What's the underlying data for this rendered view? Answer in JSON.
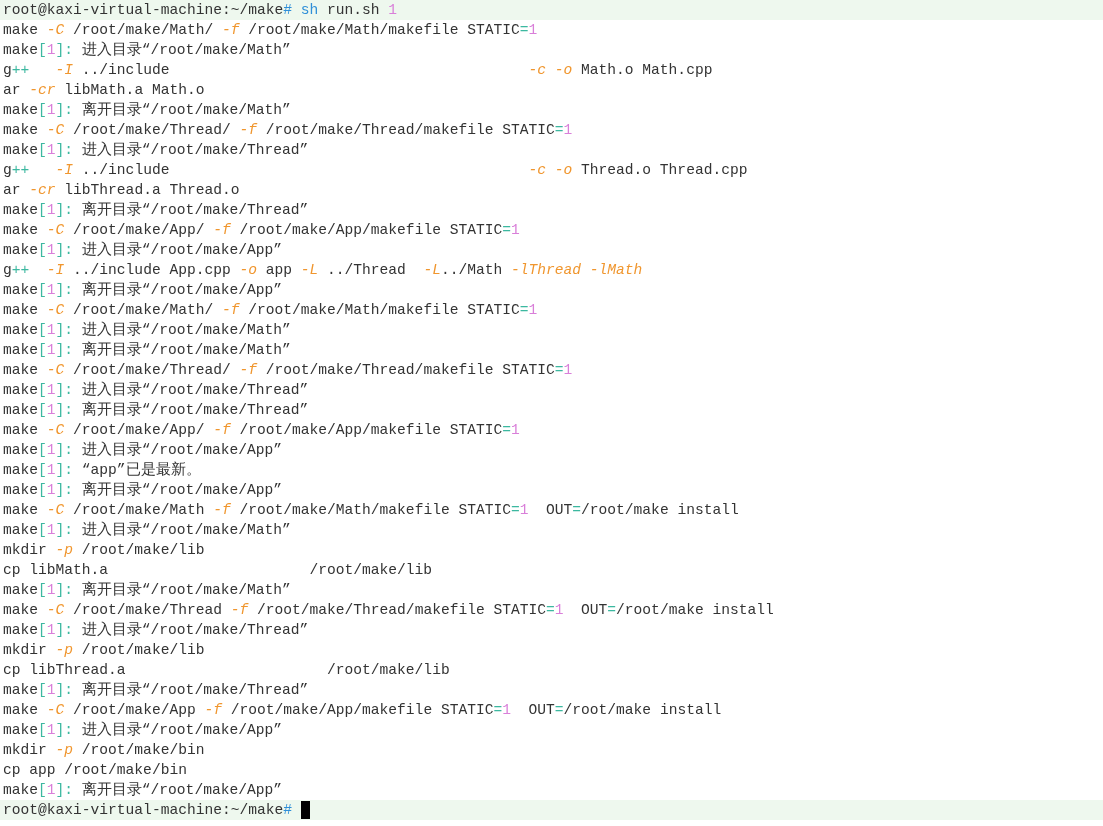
{
  "terminal": {
    "cursor": true,
    "lines": [
      {
        "kind": "prompt",
        "segments": [
          {
            "text": "root@kaxi-virtual-machine:~/make"
          },
          {
            "text": "#",
            "kind": "keyword"
          },
          {
            "text": " sh",
            "kind": "keyword"
          },
          {
            "text": " run.sh "
          },
          {
            "text": "1",
            "kind": "number"
          }
        ]
      },
      {
        "kind": "output",
        "segments": [
          {
            "text": "make "
          },
          {
            "text": "-C",
            "kind": "option"
          },
          {
            "text": " /root/make/Math/ "
          },
          {
            "text": "-f",
            "kind": "option"
          },
          {
            "text": " /root/make/Math/makefile STATIC"
          },
          {
            "text": "=",
            "kind": "symbol"
          },
          {
            "text": "1",
            "kind": "number"
          }
        ]
      },
      {
        "kind": "output",
        "segments": [
          {
            "text": "make"
          },
          {
            "text": "[",
            "kind": "symbol"
          },
          {
            "text": "1",
            "kind": "number"
          },
          {
            "text": "]:",
            "kind": "symbol"
          },
          {
            "text": " 进入目录“/root/make/Math”"
          }
        ]
      },
      {
        "kind": "output",
        "segments": [
          {
            "text": "g"
          },
          {
            "text": "++",
            "kind": "symbol"
          },
          {
            "text": "   -I",
            "kind": "option"
          },
          {
            "text": " ../include                                         "
          },
          {
            "text": "-c",
            "kind": "option"
          },
          {
            "text": " -o",
            "kind": "option"
          },
          {
            "text": " Math.o Math.cpp"
          }
        ]
      },
      {
        "kind": "output",
        "segments": [
          {
            "text": "ar "
          },
          {
            "text": "-cr",
            "kind": "option"
          },
          {
            "text": " libMath.a Math.o"
          }
        ]
      },
      {
        "kind": "output",
        "segments": [
          {
            "text": "make"
          },
          {
            "text": "[",
            "kind": "symbol"
          },
          {
            "text": "1",
            "kind": "number"
          },
          {
            "text": "]:",
            "kind": "symbol"
          },
          {
            "text": " 离开目录“/root/make/Math”"
          }
        ]
      },
      {
        "kind": "output",
        "segments": [
          {
            "text": "make "
          },
          {
            "text": "-C",
            "kind": "option"
          },
          {
            "text": " /root/make/Thread/ "
          },
          {
            "text": "-f",
            "kind": "option"
          },
          {
            "text": " /root/make/Thread/makefile STATIC"
          },
          {
            "text": "=",
            "kind": "symbol"
          },
          {
            "text": "1",
            "kind": "number"
          }
        ]
      },
      {
        "kind": "output",
        "segments": [
          {
            "text": "make"
          },
          {
            "text": "[",
            "kind": "symbol"
          },
          {
            "text": "1",
            "kind": "number"
          },
          {
            "text": "]:",
            "kind": "symbol"
          },
          {
            "text": " 进入目录“/root/make/Thread”"
          }
        ]
      },
      {
        "kind": "output",
        "segments": [
          {
            "text": "g"
          },
          {
            "text": "++",
            "kind": "symbol"
          },
          {
            "text": "   -I",
            "kind": "option"
          },
          {
            "text": " ../include                                         "
          },
          {
            "text": "-c",
            "kind": "option"
          },
          {
            "text": " -o",
            "kind": "option"
          },
          {
            "text": " Thread.o Thread.cpp"
          }
        ]
      },
      {
        "kind": "output",
        "segments": [
          {
            "text": "ar "
          },
          {
            "text": "-cr",
            "kind": "option"
          },
          {
            "text": " libThread.a Thread.o"
          }
        ]
      },
      {
        "kind": "output",
        "segments": [
          {
            "text": "make"
          },
          {
            "text": "[",
            "kind": "symbol"
          },
          {
            "text": "1",
            "kind": "number"
          },
          {
            "text": "]:",
            "kind": "symbol"
          },
          {
            "text": " 离开目录“/root/make/Thread”"
          }
        ]
      },
      {
        "kind": "output",
        "segments": [
          {
            "text": "make "
          },
          {
            "text": "-C",
            "kind": "option"
          },
          {
            "text": " /root/make/App/ "
          },
          {
            "text": "-f",
            "kind": "option"
          },
          {
            "text": " /root/make/App/makefile STATIC"
          },
          {
            "text": "=",
            "kind": "symbol"
          },
          {
            "text": "1",
            "kind": "number"
          }
        ]
      },
      {
        "kind": "output",
        "segments": [
          {
            "text": "make"
          },
          {
            "text": "[",
            "kind": "symbol"
          },
          {
            "text": "1",
            "kind": "number"
          },
          {
            "text": "]:",
            "kind": "symbol"
          },
          {
            "text": " 进入目录“/root/make/App”"
          }
        ]
      },
      {
        "kind": "output",
        "segments": [
          {
            "text": "g"
          },
          {
            "text": "++",
            "kind": "symbol"
          },
          {
            "text": "  -I",
            "kind": "option"
          },
          {
            "text": " ../include App.cpp "
          },
          {
            "text": "-o",
            "kind": "option"
          },
          {
            "text": " app "
          },
          {
            "text": "-L",
            "kind": "option"
          },
          {
            "text": " ../Thread  "
          },
          {
            "text": "-L",
            "kind": "option"
          },
          {
            "text": "../Math "
          },
          {
            "text": "-lThread",
            "kind": "option"
          },
          {
            "text": " -lMath",
            "kind": "option"
          }
        ]
      },
      {
        "kind": "output",
        "segments": [
          {
            "text": "make"
          },
          {
            "text": "[",
            "kind": "symbol"
          },
          {
            "text": "1",
            "kind": "number"
          },
          {
            "text": "]:",
            "kind": "symbol"
          },
          {
            "text": " 离开目录“/root/make/App”"
          }
        ]
      },
      {
        "kind": "output",
        "segments": [
          {
            "text": "make "
          },
          {
            "text": "-C",
            "kind": "option"
          },
          {
            "text": " /root/make/Math/ "
          },
          {
            "text": "-f",
            "kind": "option"
          },
          {
            "text": " /root/make/Math/makefile STATIC"
          },
          {
            "text": "=",
            "kind": "symbol"
          },
          {
            "text": "1",
            "kind": "number"
          }
        ]
      },
      {
        "kind": "output",
        "segments": [
          {
            "text": "make"
          },
          {
            "text": "[",
            "kind": "symbol"
          },
          {
            "text": "1",
            "kind": "number"
          },
          {
            "text": "]:",
            "kind": "symbol"
          },
          {
            "text": " 进入目录“/root/make/Math”"
          }
        ]
      },
      {
        "kind": "output",
        "segments": [
          {
            "text": "make"
          },
          {
            "text": "[",
            "kind": "symbol"
          },
          {
            "text": "1",
            "kind": "number"
          },
          {
            "text": "]:",
            "kind": "symbol"
          },
          {
            "text": " 离开目录“/root/make/Math”"
          }
        ]
      },
      {
        "kind": "output",
        "segments": [
          {
            "text": "make "
          },
          {
            "text": "-C",
            "kind": "option"
          },
          {
            "text": " /root/make/Thread/ "
          },
          {
            "text": "-f",
            "kind": "option"
          },
          {
            "text": " /root/make/Thread/makefile STATIC"
          },
          {
            "text": "=",
            "kind": "symbol"
          },
          {
            "text": "1",
            "kind": "number"
          }
        ]
      },
      {
        "kind": "output",
        "segments": [
          {
            "text": "make"
          },
          {
            "text": "[",
            "kind": "symbol"
          },
          {
            "text": "1",
            "kind": "number"
          },
          {
            "text": "]:",
            "kind": "symbol"
          },
          {
            "text": " 进入目录“/root/make/Thread”"
          }
        ]
      },
      {
        "kind": "output",
        "segments": [
          {
            "text": "make"
          },
          {
            "text": "[",
            "kind": "symbol"
          },
          {
            "text": "1",
            "kind": "number"
          },
          {
            "text": "]:",
            "kind": "symbol"
          },
          {
            "text": " 离开目录“/root/make/Thread”"
          }
        ]
      },
      {
        "kind": "output",
        "segments": [
          {
            "text": "make "
          },
          {
            "text": "-C",
            "kind": "option"
          },
          {
            "text": " /root/make/App/ "
          },
          {
            "text": "-f",
            "kind": "option"
          },
          {
            "text": " /root/make/App/makefile STATIC"
          },
          {
            "text": "=",
            "kind": "symbol"
          },
          {
            "text": "1",
            "kind": "number"
          }
        ]
      },
      {
        "kind": "output",
        "segments": [
          {
            "text": "make"
          },
          {
            "text": "[",
            "kind": "symbol"
          },
          {
            "text": "1",
            "kind": "number"
          },
          {
            "text": "]:",
            "kind": "symbol"
          },
          {
            "text": " 进入目录“/root/make/App”"
          }
        ]
      },
      {
        "kind": "output",
        "segments": [
          {
            "text": "make"
          },
          {
            "text": "[",
            "kind": "symbol"
          },
          {
            "text": "1",
            "kind": "number"
          },
          {
            "text": "]:",
            "kind": "symbol"
          },
          {
            "text": " “app”已是最新。"
          }
        ]
      },
      {
        "kind": "output",
        "segments": [
          {
            "text": "make"
          },
          {
            "text": "[",
            "kind": "symbol"
          },
          {
            "text": "1",
            "kind": "number"
          },
          {
            "text": "]:",
            "kind": "symbol"
          },
          {
            "text": " 离开目录“/root/make/App”"
          }
        ]
      },
      {
        "kind": "output",
        "segments": [
          {
            "text": "make "
          },
          {
            "text": "-C",
            "kind": "option"
          },
          {
            "text": " /root/make/Math "
          },
          {
            "text": "-f",
            "kind": "option"
          },
          {
            "text": " /root/make/Math/makefile STATIC"
          },
          {
            "text": "=",
            "kind": "symbol"
          },
          {
            "text": "1",
            "kind": "number"
          },
          {
            "text": "  OUT"
          },
          {
            "text": "=",
            "kind": "symbol"
          },
          {
            "text": "/root/make install"
          }
        ]
      },
      {
        "kind": "output",
        "segments": [
          {
            "text": "make"
          },
          {
            "text": "[",
            "kind": "symbol"
          },
          {
            "text": "1",
            "kind": "number"
          },
          {
            "text": "]:",
            "kind": "symbol"
          },
          {
            "text": " 进入目录“/root/make/Math”"
          }
        ]
      },
      {
        "kind": "output",
        "segments": [
          {
            "text": "mkdir "
          },
          {
            "text": "-p",
            "kind": "option"
          },
          {
            "text": " /root/make/lib"
          }
        ]
      },
      {
        "kind": "output",
        "segments": [
          {
            "text": "cp libMath.a                       /root/make/lib"
          }
        ]
      },
      {
        "kind": "output",
        "segments": [
          {
            "text": "make"
          },
          {
            "text": "[",
            "kind": "symbol"
          },
          {
            "text": "1",
            "kind": "number"
          },
          {
            "text": "]:",
            "kind": "symbol"
          },
          {
            "text": " 离开目录“/root/make/Math”"
          }
        ]
      },
      {
        "kind": "output",
        "segments": [
          {
            "text": "make "
          },
          {
            "text": "-C",
            "kind": "option"
          },
          {
            "text": " /root/make/Thread "
          },
          {
            "text": "-f",
            "kind": "option"
          },
          {
            "text": " /root/make/Thread/makefile STATIC"
          },
          {
            "text": "=",
            "kind": "symbol"
          },
          {
            "text": "1",
            "kind": "number"
          },
          {
            "text": "  OUT"
          },
          {
            "text": "=",
            "kind": "symbol"
          },
          {
            "text": "/root/make install"
          }
        ]
      },
      {
        "kind": "output",
        "segments": [
          {
            "text": "make"
          },
          {
            "text": "[",
            "kind": "symbol"
          },
          {
            "text": "1",
            "kind": "number"
          },
          {
            "text": "]:",
            "kind": "symbol"
          },
          {
            "text": " 进入目录“/root/make/Thread”"
          }
        ]
      },
      {
        "kind": "output",
        "segments": [
          {
            "text": "mkdir "
          },
          {
            "text": "-p",
            "kind": "option"
          },
          {
            "text": " /root/make/lib"
          }
        ]
      },
      {
        "kind": "output",
        "segments": [
          {
            "text": "cp libThread.a                       /root/make/lib"
          }
        ]
      },
      {
        "kind": "output",
        "segments": [
          {
            "text": "make"
          },
          {
            "text": "[",
            "kind": "symbol"
          },
          {
            "text": "1",
            "kind": "number"
          },
          {
            "text": "]:",
            "kind": "symbol"
          },
          {
            "text": " 离开目录“/root/make/Thread”"
          }
        ]
      },
      {
        "kind": "output",
        "segments": [
          {
            "text": "make "
          },
          {
            "text": "-C",
            "kind": "option"
          },
          {
            "text": " /root/make/App "
          },
          {
            "text": "-f",
            "kind": "option"
          },
          {
            "text": " /root/make/App/makefile STATIC"
          },
          {
            "text": "=",
            "kind": "symbol"
          },
          {
            "text": "1",
            "kind": "number"
          },
          {
            "text": "  OUT"
          },
          {
            "text": "=",
            "kind": "symbol"
          },
          {
            "text": "/root/make install"
          }
        ]
      },
      {
        "kind": "output",
        "segments": [
          {
            "text": "make"
          },
          {
            "text": "[",
            "kind": "symbol"
          },
          {
            "text": "1",
            "kind": "number"
          },
          {
            "text": "]:",
            "kind": "symbol"
          },
          {
            "text": " 进入目录“/root/make/App”"
          }
        ]
      },
      {
        "kind": "output",
        "segments": [
          {
            "text": "mkdir "
          },
          {
            "text": "-p",
            "kind": "option"
          },
          {
            "text": " /root/make/bin"
          }
        ]
      },
      {
        "kind": "output",
        "segments": [
          {
            "text": "cp app /root/make/bin"
          }
        ]
      },
      {
        "kind": "output",
        "segments": [
          {
            "text": "make"
          },
          {
            "text": "[",
            "kind": "symbol"
          },
          {
            "text": "1",
            "kind": "number"
          },
          {
            "text": "]:",
            "kind": "symbol"
          },
          {
            "text": " 离开目录“/root/make/App”"
          }
        ]
      },
      {
        "kind": "prompt",
        "segments": [
          {
            "text": "root@kaxi-virtual-machine:~/make"
          },
          {
            "text": "#",
            "kind": "keyword"
          }
        ]
      }
    ]
  }
}
